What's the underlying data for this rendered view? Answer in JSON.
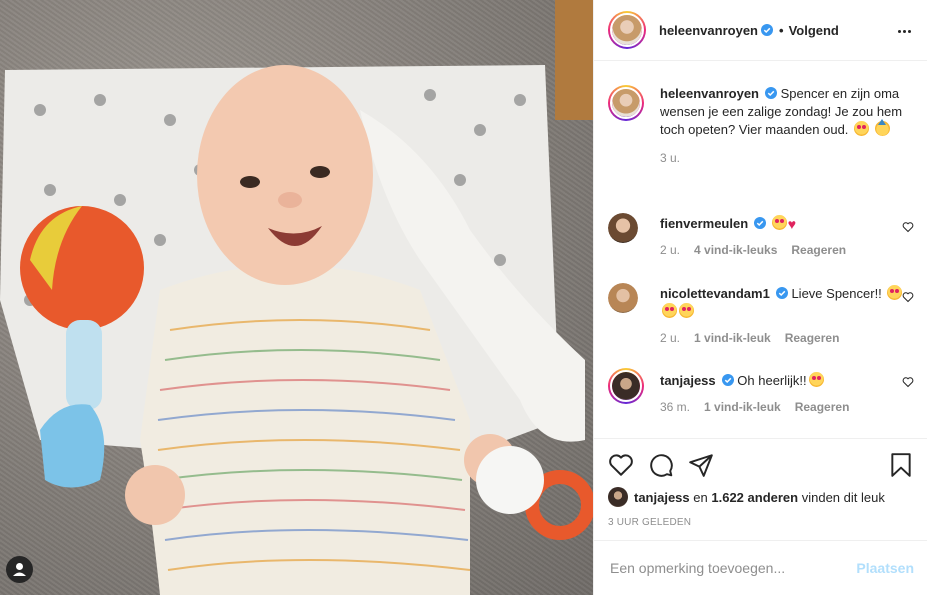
{
  "post": {
    "author": "heleenvanroyen",
    "follow_label": "Volgend",
    "dot": "•",
    "caption_text": "Spencer en zijn oma wensen je een zalige zondag! Je zou hem toch opeten? Vier maanden oud.",
    "caption_time": "3 u.",
    "photo_icon": "user-tag-icon"
  },
  "comments": [
    {
      "username": "fienvermeulen",
      "text": "",
      "emojis": [
        "heart-eyes",
        "red-heart"
      ],
      "time": "2 u.",
      "likes": "4 vind-ik-leuks",
      "reply_label": "Reageren"
    },
    {
      "username": "nicolettevandam1",
      "text": "Lieve Spencer!!",
      "emojis": [
        "heart-eyes",
        "heart-eyes",
        "heart-eyes"
      ],
      "time": "2 u.",
      "likes": "1 vind-ik-leuk",
      "reply_label": "Reageren"
    },
    {
      "username": "tanjajess",
      "text": "Oh heerlijk!!",
      "emojis": [
        "heart-eyes"
      ],
      "time": "36 m.",
      "likes": "1 vind-ik-leuk",
      "reply_label": "Reageren"
    }
  ],
  "likes": {
    "liker": "tanjajess",
    "connector": "en",
    "others": "1.622 anderen",
    "suffix": "vinden dit leuk"
  },
  "timestamp": "3 UUR GELEDEN",
  "add_comment": {
    "placeholder": "Een opmerking toevoegen...",
    "post_label": "Plaatsen"
  },
  "icons": {
    "like": "heart-icon",
    "comment": "comment-icon",
    "share": "share-icon",
    "save": "bookmark-icon",
    "more": "more-options-icon",
    "verified": "verified-badge-icon"
  },
  "colors": {
    "verified": "#3897f0",
    "post_disabled": "#b2dffc",
    "muted": "#8e8e8e",
    "text": "#262626"
  }
}
